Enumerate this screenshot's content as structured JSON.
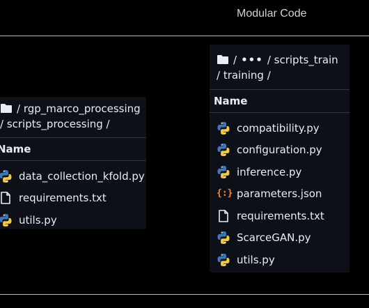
{
  "header": {
    "title": "Modular Code"
  },
  "left_panel": {
    "breadcrumb": {
      "sep1": "/",
      "folder": "rgp_marco_processing",
      "line2": "/ scripts_processing /"
    },
    "column_header": "Name",
    "files": [
      {
        "name": "data_collection_kfold.py",
        "icon": "python-icon"
      },
      {
        "name": "requirements.txt",
        "icon": "file-icon"
      },
      {
        "name": "utils.py",
        "icon": "python-icon"
      }
    ]
  },
  "right_panel": {
    "breadcrumb": {
      "sep1": "/",
      "ellipsis": "•••",
      "folder": "/ scripts_train",
      "line2": "/ training /"
    },
    "column_header": "Name",
    "files": [
      {
        "name": "compatibility.py",
        "icon": "python-icon"
      },
      {
        "name": "configuration.py",
        "icon": "python-icon"
      },
      {
        "name": "inference.py",
        "icon": "python-icon"
      },
      {
        "name": "parameters.json",
        "icon": "json-icon",
        "glyph": "{:}"
      },
      {
        "name": "requirements.txt",
        "icon": "file-icon"
      },
      {
        "name": "ScarceGAN.py",
        "icon": "python-icon"
      },
      {
        "name": "utils.py",
        "icon": "python-icon"
      }
    ]
  },
  "colors": {
    "background": "#000000",
    "panel": "#0d1117",
    "python_blue": "#3b78b4",
    "python_yellow": "#f3c93c",
    "json_orange": "#f0883e"
  }
}
